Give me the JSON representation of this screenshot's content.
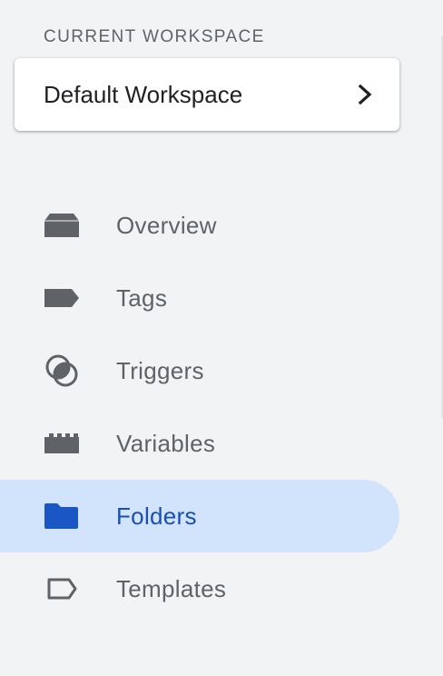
{
  "workspace": {
    "section_label": "CURRENT WORKSPACE",
    "name": "Default Workspace"
  },
  "nav": {
    "items": [
      {
        "label": "Overview",
        "icon": "overview-icon"
      },
      {
        "label": "Tags",
        "icon": "tag-icon"
      },
      {
        "label": "Triggers",
        "icon": "triggers-icon"
      },
      {
        "label": "Variables",
        "icon": "variables-icon"
      },
      {
        "label": "Folders",
        "icon": "folder-icon",
        "active": true
      },
      {
        "label": "Templates",
        "icon": "template-icon"
      }
    ]
  },
  "colors": {
    "background": "#f1f3f4",
    "icon": "#5f6368",
    "active_background": "#d2e3fc",
    "active_text": "#1a4fb5",
    "active_icon": "#1a56c4"
  }
}
